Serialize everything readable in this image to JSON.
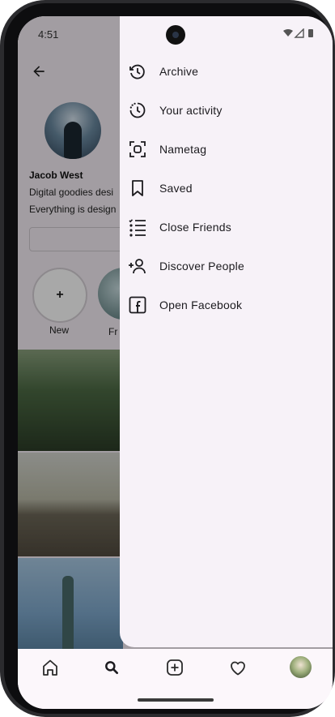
{
  "status_bar": {
    "time": "4:51"
  },
  "profile": {
    "name": "Jacob West",
    "bio_line1": "Digital goodies desi",
    "bio_line2": "Everything is design",
    "highlights": [
      {
        "label": "New",
        "symbol": "+"
      },
      {
        "label": "Fr"
      }
    ]
  },
  "drawer": {
    "items": [
      {
        "label": "Archive",
        "icon": "archive-icon"
      },
      {
        "label": "Your activity",
        "icon": "activity-icon"
      },
      {
        "label": "Nametag",
        "icon": "nametag-icon"
      },
      {
        "label": "Saved",
        "icon": "bookmark-icon"
      },
      {
        "label": "Close Friends",
        "icon": "close-friends-icon"
      },
      {
        "label": "Discover People",
        "icon": "add-person-icon"
      },
      {
        "label": "Open Facebook",
        "icon": "facebook-icon"
      }
    ]
  },
  "bottom_nav": {
    "items": [
      "home-icon",
      "search-icon",
      "add-post-icon",
      "heart-icon",
      "profile-avatar"
    ]
  },
  "colors": {
    "drawer_bg": "#f7f2f8",
    "scrim": "rgba(0,0,0,0.34)",
    "text": "#1c1b1f"
  }
}
